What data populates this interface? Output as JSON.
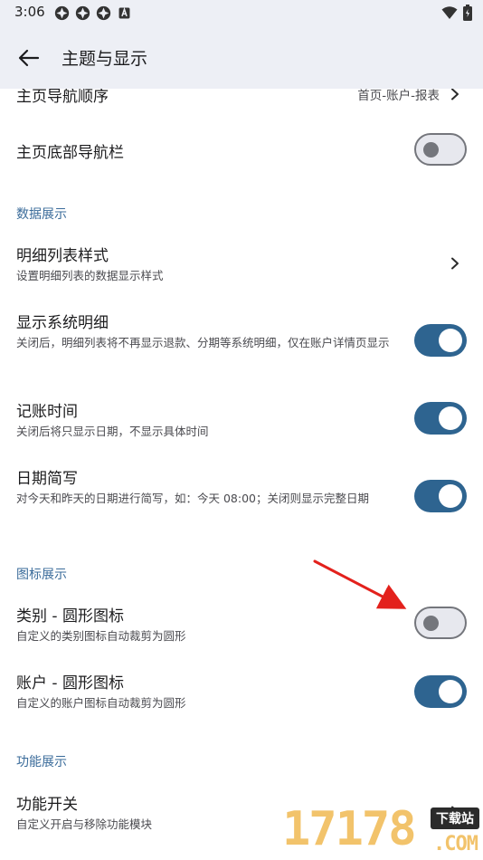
{
  "status_bar": {
    "time": "3:06",
    "left_icons": [
      "app-notification-icon",
      "app-notification-icon",
      "app-notification-icon",
      "a-notification-icon"
    ],
    "right_icons": [
      "wifi-icon",
      "battery-icon"
    ]
  },
  "app_bar": {
    "back_icon": "arrow-left-icon",
    "title": "主题与显示"
  },
  "rows_top": [
    {
      "title": "主页导航顺序",
      "value": "首页-账户-报表"
    },
    {
      "title": "主页底部导航栏",
      "switch_on": false
    }
  ],
  "sections": {
    "data_display": "数据展示",
    "icon_display": "图标展示",
    "feature_display": "功能展示"
  },
  "data_rows": [
    {
      "title": "明细列表样式",
      "subtitle": "设置明细列表的数据显示样式"
    },
    {
      "title": "显示系统明细",
      "subtitle": "关闭后，明细列表将不再显示退款、分期等系统明细，仅在账户详情页显示",
      "switch_on": true
    },
    {
      "title": "记账时间",
      "subtitle": "关闭后将只显示日期，不显示具体时间",
      "switch_on": true
    },
    {
      "title": "日期简写",
      "subtitle": "对今天和昨天的日期进行简写，如：今天 08:00；关闭则显示完整日期",
      "switch_on": true
    }
  ],
  "icon_rows": [
    {
      "title": "类别 - 圆形图标",
      "subtitle": "自定义的类别图标自动裁剪为圆形",
      "switch_on": false
    },
    {
      "title": "账户 - 圆形图标",
      "subtitle": "自定义的账户图标自动裁剪为圆形",
      "switch_on": true
    }
  ],
  "feature_rows": [
    {
      "title": "功能开关",
      "subtitle": "自定义开启与移除功能模块"
    }
  ],
  "watermark": {
    "number": "17178",
    "badge": "下载站",
    "domain": ".COM"
  },
  "colors": {
    "switch_on": "#2e6490",
    "switch_off_track": "#e7e8ee",
    "switch_off_border": "#74767c",
    "section_header": "#3a6b9a",
    "app_bar_bg": "#edeff5",
    "annotation_arrow": "#e3211c"
  }
}
